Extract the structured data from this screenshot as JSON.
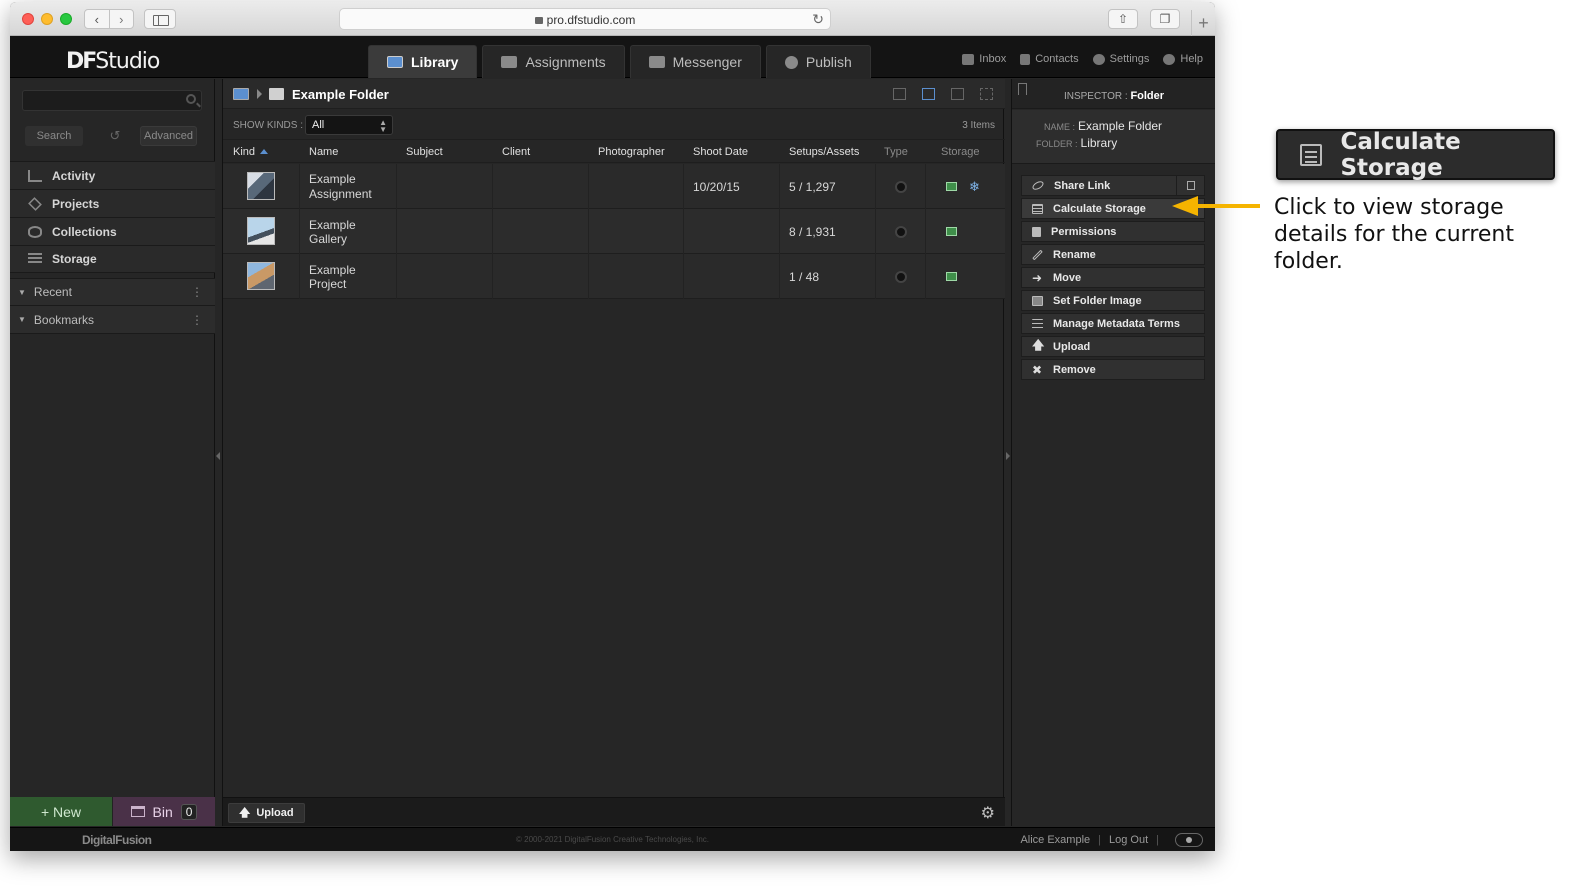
{
  "browser": {
    "url": "pro.dfstudio.com"
  },
  "app": {
    "logo": "DFStudio",
    "logo_prefix": "DF",
    "logo_suffix": "Studio",
    "tabs": [
      {
        "label": "Library",
        "active": true
      },
      {
        "label": "Assignments",
        "active": false
      },
      {
        "label": "Messenger",
        "active": false
      },
      {
        "label": "Publish",
        "active": false
      }
    ],
    "toplinks": {
      "inbox": "Inbox",
      "contacts": "Contacts",
      "settings": "Settings",
      "help": "Help"
    }
  },
  "sidebar": {
    "search_label": "Search",
    "advanced_label": "Advanced",
    "nav": [
      {
        "label": "Activity",
        "icon": "bar-chart-icon"
      },
      {
        "label": "Projects",
        "icon": "layers-icon"
      },
      {
        "label": "Collections",
        "icon": "stack-icon"
      },
      {
        "label": "Storage",
        "icon": "storage-icon"
      }
    ],
    "sections": [
      {
        "label": "Recent"
      },
      {
        "label": "Bookmarks"
      }
    ],
    "new_label": "+ New",
    "bin_label": "Bin",
    "bin_count": "0"
  },
  "library": {
    "folder_title": "Example Folder",
    "show_kinds_label": "SHOW KINDS :",
    "show_kinds_value": "All",
    "item_count": "3 Items",
    "columns": {
      "kind": "Kind",
      "name": "Name",
      "subject": "Subject",
      "client": "Client",
      "photographer": "Photographer",
      "shoot_date": "Shoot Date",
      "setups_assets": "Setups/Assets",
      "type": "Type",
      "storage": "Storage"
    },
    "rows": [
      {
        "name_line1": "Example",
        "name_line2": "Assignment",
        "shoot_date": "10/20/15",
        "setups_assets": "5 / 1,297",
        "snow": "❄"
      },
      {
        "name_line1": "Example Gallery",
        "name_line2": "",
        "shoot_date": "",
        "setups_assets": "8 / 1,931",
        "snow": ""
      },
      {
        "name_line1": "Example Project",
        "name_line2": "",
        "shoot_date": "",
        "setups_assets": "1 / 48",
        "snow": ""
      }
    ],
    "upload_label": "Upload"
  },
  "inspector": {
    "title_prefix": "INSPECTOR :",
    "title_value": "Folder",
    "name_label": "NAME :",
    "name_value": "Example Folder",
    "folder_label": "FOLDER :",
    "folder_value": "Library",
    "actions": [
      {
        "label": "Share Link"
      },
      {
        "label": "Calculate Storage"
      },
      {
        "label": "Permissions"
      },
      {
        "label": "Rename"
      },
      {
        "label": "Move"
      },
      {
        "label": "Set Folder Image"
      },
      {
        "label": "Manage Metadata Terms"
      },
      {
        "label": "Upload"
      },
      {
        "label": "Remove"
      }
    ]
  },
  "footer": {
    "logo": "DigitalFusion",
    "copyright": "© 2000-2021 DigitalFusion Creative Technologies, Inc.",
    "user": "Alice Example",
    "logout": "Log Out"
  },
  "annotation": {
    "callout_label": "Calculate Storage",
    "note": "Click to view storage details for the current folder.",
    "arrow_color": "#f5b400"
  }
}
